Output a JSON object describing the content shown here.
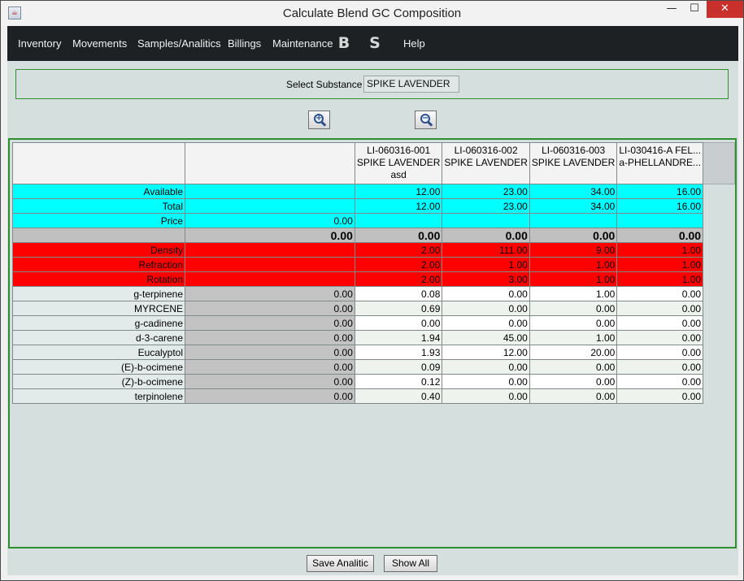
{
  "window": {
    "title": "Calculate Blend GC Composition",
    "app_icon": "java-app-icon",
    "controls": {
      "minimize": "—",
      "maximize": "☐",
      "close": "✕"
    }
  },
  "menu": {
    "items": [
      {
        "label": "Inventory"
      },
      {
        "label": "Movements"
      },
      {
        "label": "Samples/Analitics"
      },
      {
        "label": "Billings"
      },
      {
        "label": "Maintenance"
      },
      {
        "label": "B",
        "icon": "b-icon"
      },
      {
        "label": "S",
        "icon": "s-icon"
      },
      {
        "label": "Help"
      }
    ]
  },
  "selector": {
    "label": "Select Substance",
    "value": "SPIKE LAVENDER"
  },
  "zoom": {
    "in_icon": "zoom-in-icon",
    "out_icon": "zoom-out-icon"
  },
  "table": {
    "headers": [
      {
        "line1": "",
        "line2": "",
        "line3": ""
      },
      {
        "line1": "",
        "line2": "",
        "line3": ""
      },
      {
        "line1": "LI-060316-001",
        "line2": "SPIKE LAVENDER",
        "line3": "asd"
      },
      {
        "line1": "LI-060316-002",
        "line2": "SPIKE LAVENDER",
        "line3": ""
      },
      {
        "line1": "LI-060316-003",
        "line2": "SPIKE LAVENDER",
        "line3": ""
      },
      {
        "line1": "LI-030416-A FEL...",
        "line2": "a-PHELLANDRE...",
        "line3": ""
      }
    ],
    "rows": [
      {
        "label": "Available",
        "total": "",
        "values": [
          "12.00",
          "23.00",
          "34.00",
          "16.00"
        ]
      },
      {
        "label": "Total",
        "total": "",
        "values": [
          "12.00",
          "23.00",
          "34.00",
          "16.00"
        ]
      },
      {
        "label": "Price",
        "total": "0.00",
        "values": [
          "",
          "",
          "",
          ""
        ]
      },
      {
        "label": "",
        "total": "0.00",
        "values": [
          "0.00",
          "0.00",
          "0.00",
          "0.00"
        ]
      },
      {
        "label": "Density",
        "total": "",
        "values": [
          "2.00",
          "111.00",
          "9.00",
          "1.00"
        ]
      },
      {
        "label": "Refraction",
        "total": "",
        "values": [
          "2.00",
          "1.00",
          "1.00",
          "1.00"
        ]
      },
      {
        "label": "Rotation",
        "total": "",
        "values": [
          "2.00",
          "3.00",
          "1.00",
          "1.00"
        ]
      },
      {
        "label": "g-terpinene",
        "total": "0.00",
        "values": [
          "0.08",
          "0.00",
          "1.00",
          "0.00"
        ]
      },
      {
        "label": "MYRCENE",
        "total": "0.00",
        "values": [
          "0.69",
          "0.00",
          "0.00",
          "0.00"
        ]
      },
      {
        "label": "g-cadinene",
        "total": "0.00",
        "values": [
          "0.00",
          "0.00",
          "0.00",
          "0.00"
        ]
      },
      {
        "label": "d-3-carene",
        "total": "0.00",
        "values": [
          "1.94",
          "45.00",
          "1.00",
          "0.00"
        ]
      },
      {
        "label": "Eucalyptol",
        "total": "0.00",
        "values": [
          "1.93",
          "12.00",
          "20.00",
          "0.00"
        ]
      },
      {
        "label": "(E)-b-ocimene",
        "total": "0.00",
        "values": [
          "0.09",
          "0.00",
          "0.00",
          "0.00"
        ]
      },
      {
        "label": "(Z)-b-ocimene",
        "total": "0.00",
        "values": [
          "0.12",
          "0.00",
          "0.00",
          "0.00"
        ]
      },
      {
        "label": "terpinolene",
        "total": "0.00",
        "values": [
          "0.40",
          "0.00",
          "0.00",
          "0.00"
        ]
      }
    ]
  },
  "buttons": {
    "save": "Save Analitic",
    "show_all": "Show All"
  },
  "colors": {
    "menubar": "#1e2124",
    "panel_border": "#2f8f2f",
    "content_bg": "#d5e0de",
    "cyan_rows": "#00ffff",
    "red_rows": "#ff0000"
  }
}
